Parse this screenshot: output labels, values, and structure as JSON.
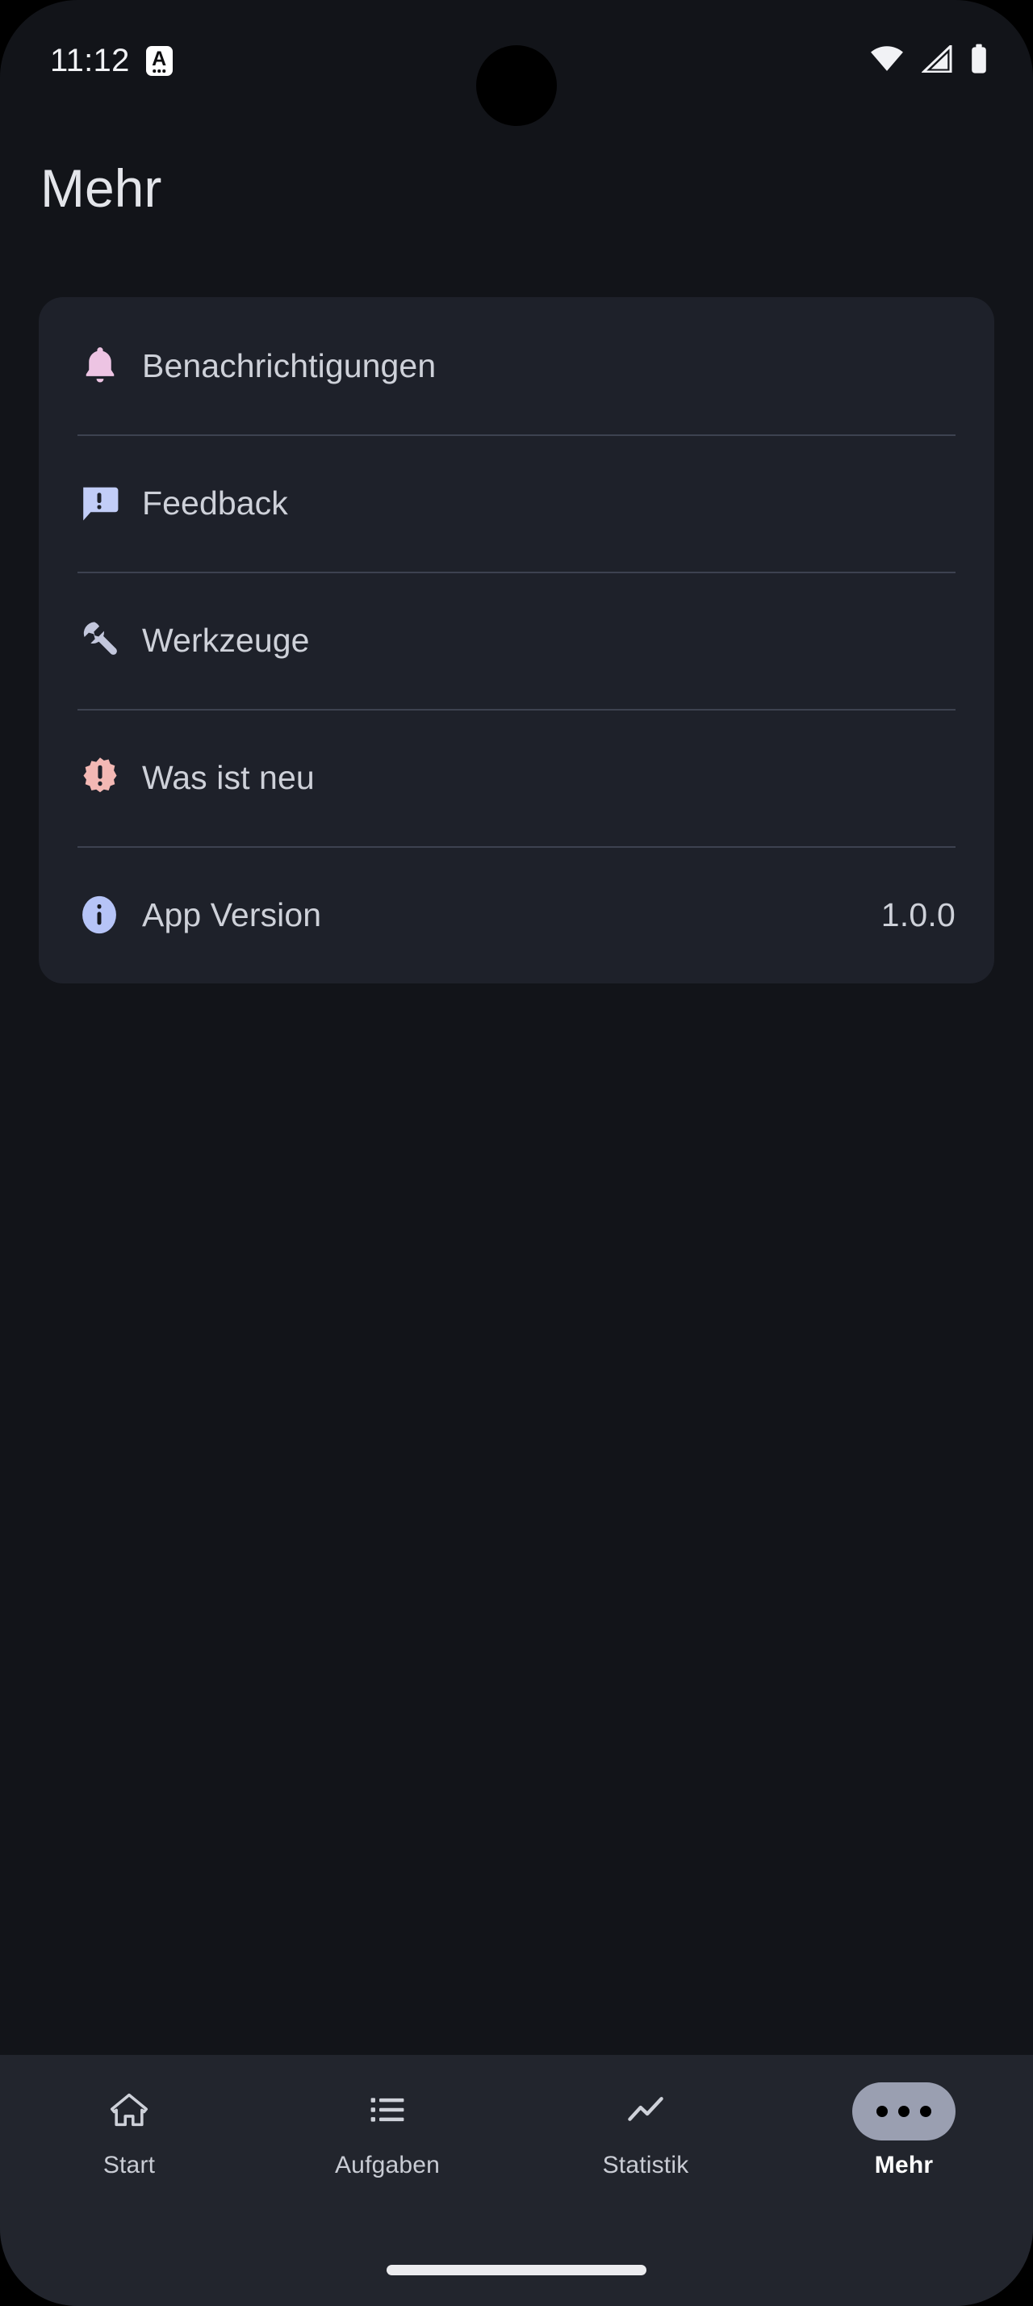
{
  "status_bar": {
    "time": "11:12",
    "app_badge_glyph": "A",
    "icons": [
      "wifi-icon",
      "cellular-signal-icon",
      "battery-icon"
    ]
  },
  "header": {
    "title": "Mehr"
  },
  "settings_card": {
    "rows": [
      {
        "label": "Benachrichtigungen",
        "icon": "bell-icon",
        "icon_color": "#edc4e3",
        "value": ""
      },
      {
        "label": "Feedback",
        "icon": "feedback-icon",
        "icon_color": "#c2cdf7",
        "value": ""
      },
      {
        "label": "Werkzeuge",
        "icon": "wrench-icon",
        "icon_color": "#c3c7dc",
        "value": ""
      },
      {
        "label": "Was ist neu",
        "icon": "new-badge-icon",
        "icon_color": "#f3b8b4",
        "value": ""
      },
      {
        "label": "App Version",
        "icon": "info-icon",
        "icon_color": "#b6c4f7",
        "value": "1.0.0"
      }
    ]
  },
  "bottom_nav": {
    "items": [
      {
        "label": "Start",
        "icon": "home-icon",
        "active": false
      },
      {
        "label": "Aufgaben",
        "icon": "list-icon",
        "active": false
      },
      {
        "label": "Statistik",
        "icon": "chart-line-icon",
        "active": false
      },
      {
        "label": "Mehr",
        "icon": "more-dots-icon",
        "active": true
      }
    ]
  },
  "colors": {
    "page_background": "#121419",
    "card_background": "#1e212a",
    "nav_background": "#22252d",
    "divider": "#3d4250",
    "text_primary": "#ced1d9",
    "text_title": "#e3e5ea",
    "active_pill": "#9a9fb1",
    "gesture_bar": "#ececef"
  }
}
